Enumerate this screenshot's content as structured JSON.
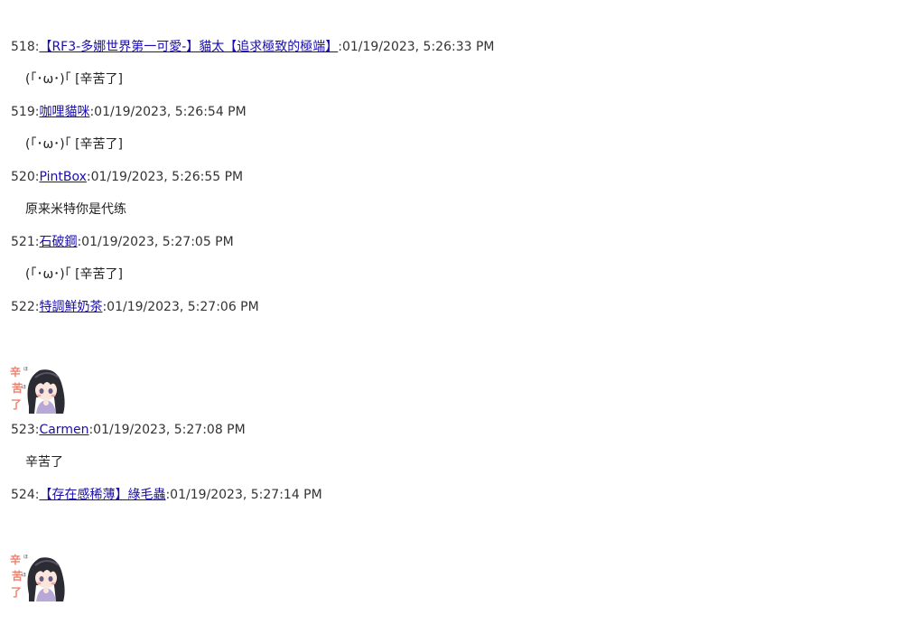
{
  "posts": [
    {
      "number": "518",
      "author": "【RF3-多娜世界第一可愛-】貓太【追求極致的極端】",
      "timestamp": "01/19/2023, 5:26:33 PM",
      "body": "(｢･ω･)｢ [辛苦了]"
    },
    {
      "number": "519",
      "author": "咖哩貓咪",
      "timestamp": "01/19/2023, 5:26:54 PM",
      "body": "(｢･ω･)｢ [辛苦了]"
    },
    {
      "number": "520",
      "author": "PintBox",
      "timestamp": "01/19/2023, 5:26:55 PM",
      "body": "原来米特你是代练"
    },
    {
      "number": "521",
      "author": "石破鋼",
      "timestamp": "01/19/2023, 5:27:05 PM",
      "body": "(｢･ω･)｢ [辛苦了]"
    },
    {
      "number": "522",
      "author": "特調鮮奶茶",
      "timestamp": "01/19/2023, 5:27:06 PM",
      "sticker_text": "辛苦了"
    },
    {
      "number": "523",
      "author": "Carmen",
      "timestamp": "01/19/2023, 5:27:08 PM",
      "body": "辛苦了"
    },
    {
      "number": "524",
      "author": "【存在感稀薄】綠毛蟲",
      "timestamp": "01/19/2023, 5:27:14 PM",
      "sticker_text": "辛苦了"
    }
  ],
  "separator": ":",
  "colors": {
    "link": "#1a0dab",
    "text": "#333333",
    "sticker_text": "#f08070",
    "hair": "#2b2b33",
    "dress": "#b8a8d8"
  }
}
